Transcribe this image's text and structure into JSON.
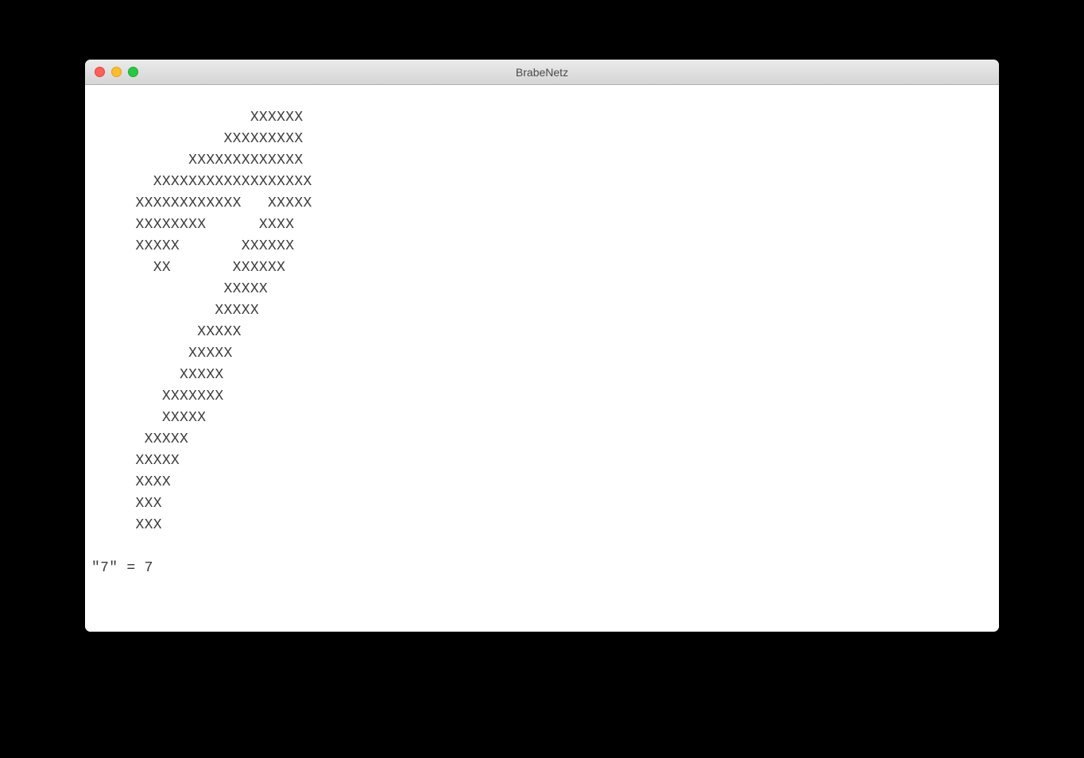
{
  "window": {
    "title": "BrabeNetz"
  },
  "terminal": {
    "ascii_art": [
      "                  XXXXXX",
      "               XXXXXXXXX",
      "           XXXXXXXXXXXXX",
      "       XXXXXXXXXXXXXXXXXX",
      "     XXXXXXXXXXXX   XXXXX",
      "     XXXXXXXX      XXXX",
      "     XXXXX       XXXXXX",
      "       XX       XXXXXX",
      "               XXXXX",
      "              XXXXX",
      "            XXXXX",
      "           XXXXX",
      "          XXXXX",
      "        XXXXXXX",
      "        XXXXX",
      "      XXXXX",
      "     XXXXX",
      "     XXXX",
      "     XXX",
      "     XXX"
    ],
    "result_line": "\"7\" = 7"
  }
}
